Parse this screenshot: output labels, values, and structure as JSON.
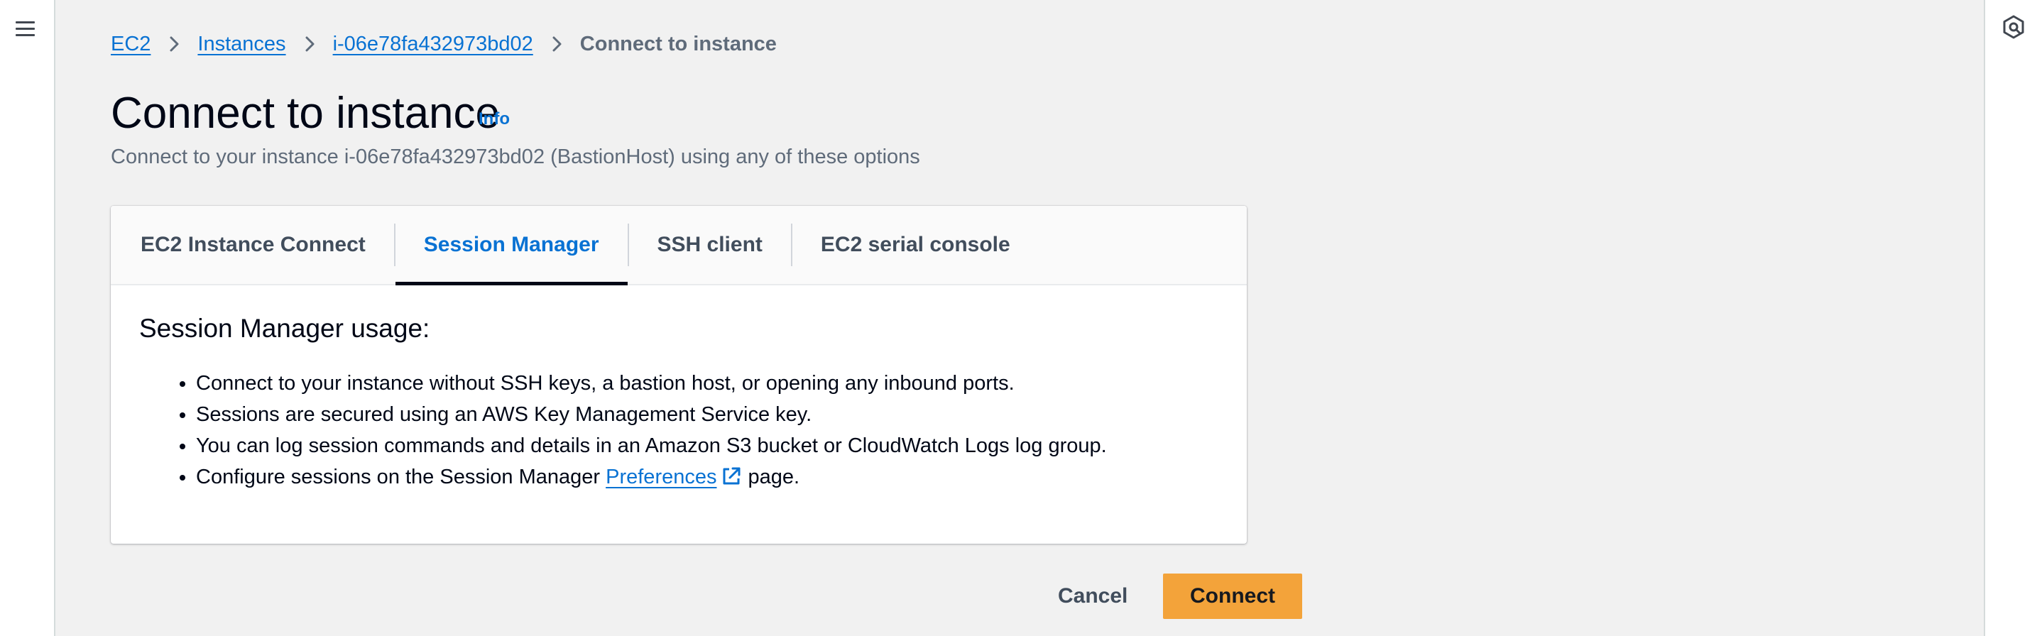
{
  "breadcrumb": {
    "items": [
      "EC2",
      "Instances",
      "i-06e78fa432973bd02"
    ],
    "current": "Connect to instance"
  },
  "header": {
    "title": "Connect to instance",
    "info_label": "Info",
    "description": "Connect to your instance i-06e78fa432973bd02 (BastionHost) using any of these options"
  },
  "tabs": [
    {
      "label": "EC2 Instance Connect",
      "selected": false
    },
    {
      "label": "Session Manager",
      "selected": true
    },
    {
      "label": "SSH client",
      "selected": false
    },
    {
      "label": "EC2 serial console",
      "selected": false
    }
  ],
  "session_manager": {
    "heading": "Session Manager usage:",
    "bullets": [
      "Connect to your instance without SSH keys, a bastion host, or opening any inbound ports.",
      "Sessions are secured using an AWS Key Management Service key.",
      "You can log session commands and details in an Amazon S3 bucket or CloudWatch Logs log group."
    ],
    "last_bullet": {
      "before": "Configure sessions on the Session Manager",
      "link": "Preferences",
      "after": "page."
    }
  },
  "actions": {
    "cancel_label": "Cancel",
    "connect_label": "Connect"
  },
  "icons": {
    "menu": "hamburger-menu-icon",
    "help": "help-panel-icon",
    "breadcrumb_separator": "chevron-right-icon",
    "external_link": "external-link-icon"
  },
  "colors": {
    "link": "#0972d3",
    "primary_button": "#f3a33a",
    "active_tab_underline": "#000716",
    "page_background": "#f1f1f1"
  }
}
